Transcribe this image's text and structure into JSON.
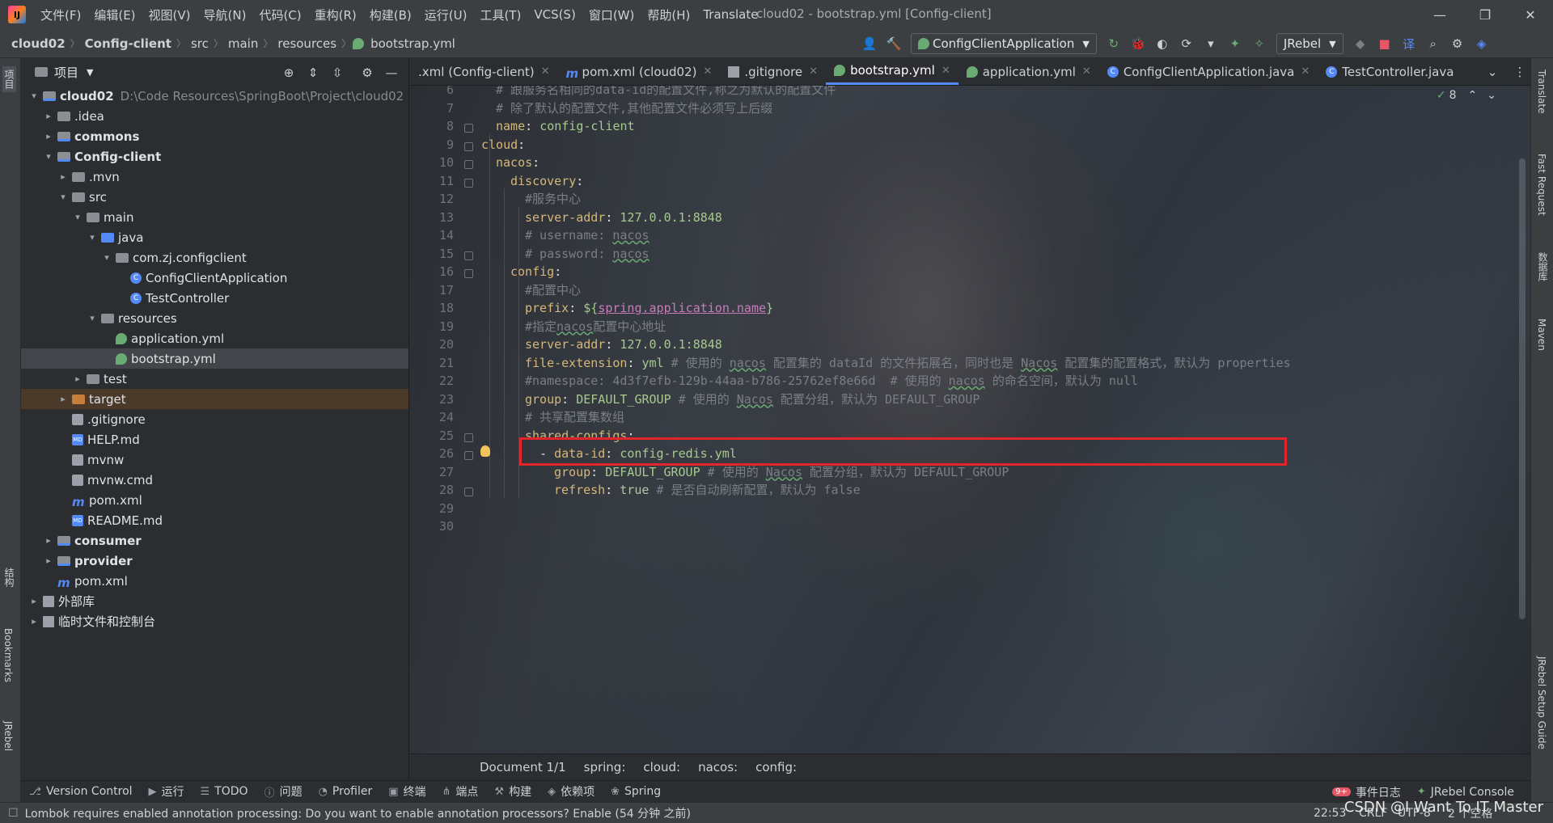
{
  "menu": {
    "items": [
      "文件(F)",
      "编辑(E)",
      "视图(V)",
      "导航(N)",
      "代码(C)",
      "重构(R)",
      "构建(B)",
      "运行(U)",
      "工具(T)",
      "VCS(S)",
      "窗口(W)",
      "帮助(H)",
      "Translate"
    ],
    "window_title": "cloud02 - bootstrap.yml [Config-client]"
  },
  "nav": {
    "crumbs": [
      "cloud02",
      "Config-client",
      "src",
      "main",
      "resources",
      "bootstrap.yml"
    ],
    "run_config": "ConfigClientApplication",
    "jrebel": "JRebel"
  },
  "left_stripe": {
    "project": "项目",
    "structure": "结构",
    "bookmarks": "Bookmarks",
    "jrebel": "JRebel"
  },
  "project": {
    "title": "项目",
    "tree": [
      {
        "label": "cloud02",
        "path": "D:\\Code Resources\\SpringBoot\\Project\\cloud02",
        "depth": 0,
        "arrow": "▾",
        "icon": "mod",
        "bold": true
      },
      {
        "label": ".idea",
        "depth": 1,
        "arrow": "▸",
        "icon": "folder"
      },
      {
        "label": "commons",
        "depth": 1,
        "arrow": "▸",
        "icon": "mod",
        "bold": true
      },
      {
        "label": "Config-client",
        "depth": 1,
        "arrow": "▾",
        "icon": "mod",
        "bold": true
      },
      {
        "label": ".mvn",
        "depth": 2,
        "arrow": "▸",
        "icon": "folder"
      },
      {
        "label": "src",
        "depth": 2,
        "arrow": "▾",
        "icon": "folder"
      },
      {
        "label": "main",
        "depth": 3,
        "arrow": "▾",
        "icon": "folder"
      },
      {
        "label": "java",
        "depth": 4,
        "arrow": "▾",
        "icon": "blue"
      },
      {
        "label": "com.zj.configclient",
        "depth": 5,
        "arrow": "▾",
        "icon": "folder"
      },
      {
        "label": "ConfigClientApplication",
        "depth": 6,
        "arrow": "",
        "icon": "class"
      },
      {
        "label": "TestController",
        "depth": 6,
        "arrow": "",
        "icon": "class"
      },
      {
        "label": "resources",
        "depth": 4,
        "arrow": "▾",
        "icon": "folder"
      },
      {
        "label": "application.yml",
        "depth": 5,
        "arrow": "",
        "icon": "yml"
      },
      {
        "label": "bootstrap.yml",
        "depth": 5,
        "arrow": "",
        "icon": "yml",
        "selected": true
      },
      {
        "label": "test",
        "depth": 3,
        "arrow": "▸",
        "icon": "folder"
      },
      {
        "label": "target",
        "depth": 2,
        "arrow": "▸",
        "icon": "orange",
        "highlight": true
      },
      {
        "label": ".gitignore",
        "depth": 2,
        "arrow": "",
        "icon": "file"
      },
      {
        "label": "HELP.md",
        "depth": 2,
        "arrow": "",
        "icon": "md"
      },
      {
        "label": "mvnw",
        "depth": 2,
        "arrow": "",
        "icon": "file"
      },
      {
        "label": "mvnw.cmd",
        "depth": 2,
        "arrow": "",
        "icon": "file"
      },
      {
        "label": "pom.xml",
        "depth": 2,
        "arrow": "",
        "icon": "m"
      },
      {
        "label": "README.md",
        "depth": 2,
        "arrow": "",
        "icon": "md"
      },
      {
        "label": "consumer",
        "depth": 1,
        "arrow": "▸",
        "icon": "mod",
        "bold": true
      },
      {
        "label": "provider",
        "depth": 1,
        "arrow": "▸",
        "icon": "mod",
        "bold": true
      },
      {
        "label": "pom.xml",
        "depth": 1,
        "arrow": "",
        "icon": "m"
      },
      {
        "label": "外部库",
        "depth": 0,
        "arrow": "▸",
        "icon": "lib"
      },
      {
        "label": "临时文件和控制台",
        "depth": 0,
        "arrow": "▸",
        "icon": "lib"
      }
    ]
  },
  "tabs": [
    {
      "label": ".xml (Config-client)",
      "icon": "none"
    },
    {
      "label": "pom.xml (cloud02)",
      "icon": "m"
    },
    {
      "label": ".gitignore",
      "icon": "file"
    },
    {
      "label": "bootstrap.yml",
      "icon": "yml",
      "active": true
    },
    {
      "label": "application.yml",
      "icon": "yml"
    },
    {
      "label": "ConfigClientApplication.java",
      "icon": "class"
    },
    {
      "label": "TestController.java",
      "icon": "class",
      "noclose": true
    }
  ],
  "editor": {
    "inspection_count": "8",
    "lines": [
      {
        "n": "6",
        "indent": 1,
        "parts": [
          [
            "c",
            "# 跟服务名相同的data-id的配置文件,称之为默认的配置文件"
          ]
        ]
      },
      {
        "n": "7",
        "indent": 1,
        "parts": [
          [
            "c",
            "# 除了默认的配置文件,其他配置文件必须写上后缀"
          ]
        ]
      },
      {
        "n": "8",
        "indent": 1,
        "fold": true,
        "parts": [
          [
            "k",
            "name"
          ],
          [
            "p",
            ": "
          ],
          [
            "s",
            "config-client"
          ]
        ]
      },
      {
        "n": "9",
        "indent": 0,
        "fold": true,
        "parts": [
          [
            "k",
            "cloud"
          ],
          [
            "p",
            ":"
          ]
        ]
      },
      {
        "n": "10",
        "indent": 1,
        "fold": true,
        "parts": [
          [
            "k",
            "nacos"
          ],
          [
            "p",
            ":"
          ]
        ]
      },
      {
        "n": "11",
        "indent": 2,
        "fold": true,
        "parts": [
          [
            "k",
            "discovery"
          ],
          [
            "p",
            ":"
          ]
        ]
      },
      {
        "n": "12",
        "indent": 3,
        "parts": [
          [
            "c",
            "#服务中心"
          ]
        ]
      },
      {
        "n": "13",
        "indent": 3,
        "parts": [
          [
            "k",
            "server-addr"
          ],
          [
            "p",
            ": "
          ],
          [
            "s",
            "127.0.0.1:8848"
          ]
        ]
      },
      {
        "n": "14",
        "indent": 3,
        "parts": [
          [
            "c",
            "# username: "
          ],
          [
            "cu",
            "nacos"
          ]
        ]
      },
      {
        "n": "15",
        "indent": 3,
        "fold": true,
        "parts": [
          [
            "c",
            "# password: "
          ],
          [
            "cu",
            "nacos"
          ]
        ]
      },
      {
        "n": "16",
        "indent": 2,
        "fold": true,
        "parts": [
          [
            "k",
            "config"
          ],
          [
            "p",
            ":"
          ]
        ]
      },
      {
        "n": "17",
        "indent": 3,
        "parts": [
          [
            "c",
            "#配置中心"
          ]
        ]
      },
      {
        "n": "18",
        "indent": 3,
        "parts": [
          [
            "k",
            "prefix"
          ],
          [
            "p",
            ": "
          ],
          [
            "s",
            "${"
          ],
          [
            "v",
            "spring.application.name"
          ],
          [
            "s",
            "}"
          ]
        ]
      },
      {
        "n": "19",
        "indent": 3,
        "parts": [
          [
            "c",
            "#指定"
          ],
          [
            "cu",
            "nacos"
          ],
          [
            "c",
            "配置中心地址"
          ]
        ]
      },
      {
        "n": "20",
        "indent": 3,
        "parts": [
          [
            "k",
            "server-addr"
          ],
          [
            "p",
            ": "
          ],
          [
            "s",
            "127.0.0.1:8848"
          ]
        ]
      },
      {
        "n": "21",
        "indent": 3,
        "parts": [
          [
            "k",
            "file-extension"
          ],
          [
            "p",
            ": "
          ],
          [
            "s",
            "yml "
          ],
          [
            "c",
            "# 使用的 "
          ],
          [
            "cu",
            "nacos"
          ],
          [
            "c",
            " 配置集的 dataId 的文件拓展名，同时也是 "
          ],
          [
            "cu",
            "Nacos"
          ],
          [
            "c",
            " 配置集的配置格式，默认为 properties"
          ]
        ]
      },
      {
        "n": "22",
        "indent": 3,
        "parts": [
          [
            "c",
            "#namespace: 4d3f7efb-129b-44aa-b786-25762ef8e66d  # 使用的 "
          ],
          [
            "cu",
            "nacos"
          ],
          [
            "c",
            " 的命名空间，默认为 null"
          ]
        ]
      },
      {
        "n": "23",
        "indent": 3,
        "parts": [
          [
            "k",
            "group"
          ],
          [
            "p",
            ": "
          ],
          [
            "s",
            "DEFAULT_GROUP "
          ],
          [
            "c",
            "# 使用的 "
          ],
          [
            "cu",
            "Nacos"
          ],
          [
            "c",
            " 配置分组，默认为 DEFAULT_GROUP"
          ]
        ]
      },
      {
        "n": "24",
        "indent": 3,
        "parts": [
          [
            "c",
            "# 共享配置集数组"
          ]
        ]
      },
      {
        "n": "25",
        "indent": 3,
        "fold": true,
        "parts": [
          [
            "k",
            "shared-configs"
          ],
          [
            "p",
            ":"
          ]
        ]
      },
      {
        "n": "26",
        "indent": 4,
        "fold": true,
        "parts": [
          [
            "p",
            "- "
          ],
          [
            "k",
            "data-id"
          ],
          [
            "p",
            ": "
          ],
          [
            "s",
            "config-redis.yml"
          ]
        ]
      },
      {
        "n": "27",
        "indent": 5,
        "parts": [
          [
            "k",
            "group"
          ],
          [
            "p",
            ": "
          ],
          [
            "s",
            "DEFAULT_GROUP "
          ],
          [
            "c",
            "# 使用的 "
          ],
          [
            "cu",
            "Nacos"
          ],
          [
            "c",
            " 配置分组，默认为 DEFAULT_GROUP"
          ]
        ]
      },
      {
        "n": "28",
        "indent": 5,
        "fold": true,
        "parts": [
          [
            "k",
            "refresh"
          ],
          [
            "p",
            ": "
          ],
          [
            "n",
            "true "
          ],
          [
            "c",
            "# 是否自动刷新配置，默认为 false"
          ]
        ]
      },
      {
        "n": "29",
        "indent": 0,
        "parts": []
      },
      {
        "n": "30",
        "indent": 0,
        "parts": []
      }
    ]
  },
  "right_stripe": {
    "translate": "Translate",
    "fast_request": "Fast Request",
    "database": "数据库",
    "maven": "Maven",
    "jrebel_guide": "JRebel Setup Guide"
  },
  "editor_crumbs": [
    "Document 1/1",
    "spring:",
    "cloud:",
    "nacos:",
    "config:"
  ],
  "bottom_tools": [
    "Version Control",
    "运行",
    "TODO",
    "问题",
    "Profiler",
    "终端",
    "端点",
    "构建",
    "依赖项",
    "Spring"
  ],
  "bottom_right": {
    "badge": "9+",
    "events": "事件日志",
    "jrebel_console": "JRebel Console"
  },
  "status": {
    "message": "Lombok requires enabled annotation processing: Do you want to enable annotation processors? Enable (54 分钟 之前)",
    "time": "22:53",
    "line_sep": "CRLF",
    "encoding": "UTF-8",
    "indent": "2 个空格"
  },
  "watermark": "CSDN @I Want To IT Master"
}
